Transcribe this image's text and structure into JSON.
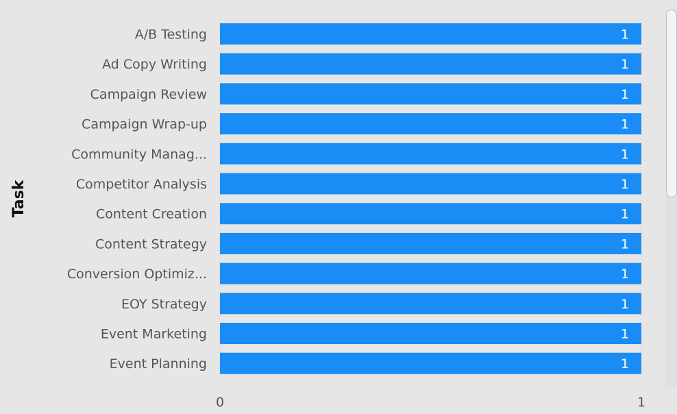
{
  "chart_data": {
    "type": "bar",
    "orientation": "horizontal",
    "ylabel": "Task",
    "xlabel": "",
    "xlim": [
      0,
      1
    ],
    "x_ticks": [
      "0",
      "1"
    ],
    "categories": [
      "A/B Testing",
      "Ad Copy Writing",
      "Campaign Review",
      "Campaign Wrap-up",
      "Community Manag...",
      "Competitor Analysis",
      "Content Creation",
      "Content Strategy",
      "Conversion Optimiz...",
      "EOY Strategy",
      "Event Marketing",
      "Event Planning"
    ],
    "values": [
      1,
      1,
      1,
      1,
      1,
      1,
      1,
      1,
      1,
      1,
      1,
      1
    ],
    "data_labels": [
      "1",
      "1",
      "1",
      "1",
      "1",
      "1",
      "1",
      "1",
      "1",
      "1",
      "1",
      "1"
    ],
    "bar_color": "#1a8cf5",
    "background_color": "#e6e6e6",
    "grid": true
  }
}
